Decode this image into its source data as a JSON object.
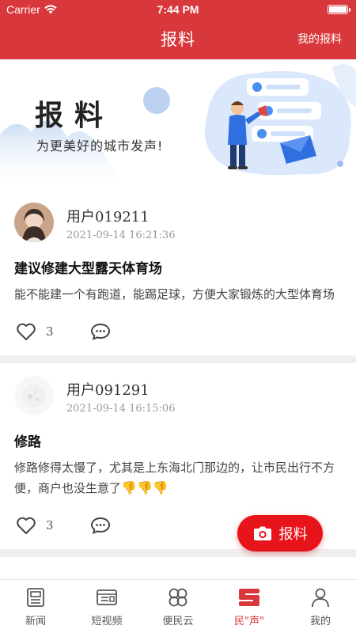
{
  "status_bar": {
    "carrier": "Carrier",
    "time": "7:44 PM"
  },
  "header": {
    "title": "报料",
    "right_link": "我的报料"
  },
  "banner": {
    "title": "报料",
    "subtitle": "为更美好的城市发声!"
  },
  "posts": [
    {
      "user": "用户019211",
      "time": "2021-09-14 16:21:36",
      "title": "建议修建大型露天体育场",
      "body": "能不能建一个有跑道，能踢足球，方便大家锻炼的大型体育场",
      "likes": "3"
    },
    {
      "user": "用户091291",
      "time": "2021-09-14 16:15:06",
      "title": "修路",
      "body": "修路修得太慢了，尤其是上东海北门那边的，让市民出行不方便，商户也没生意了",
      "emoji": "👎👎👎",
      "likes": "3"
    }
  ],
  "fab": {
    "label": "报料"
  },
  "tabs": [
    {
      "label": "新闻",
      "icon": "news-icon"
    },
    {
      "label": "短视频",
      "icon": "video-icon"
    },
    {
      "label": "便民云",
      "icon": "clover-icon"
    },
    {
      "label": "民\"声\"",
      "icon": "voice-icon"
    },
    {
      "label": "我的",
      "icon": "profile-icon"
    }
  ],
  "colors": {
    "brand_red": "#d8383b",
    "fab_red": "#e8141c",
    "active_tab": "#d8383b"
  }
}
